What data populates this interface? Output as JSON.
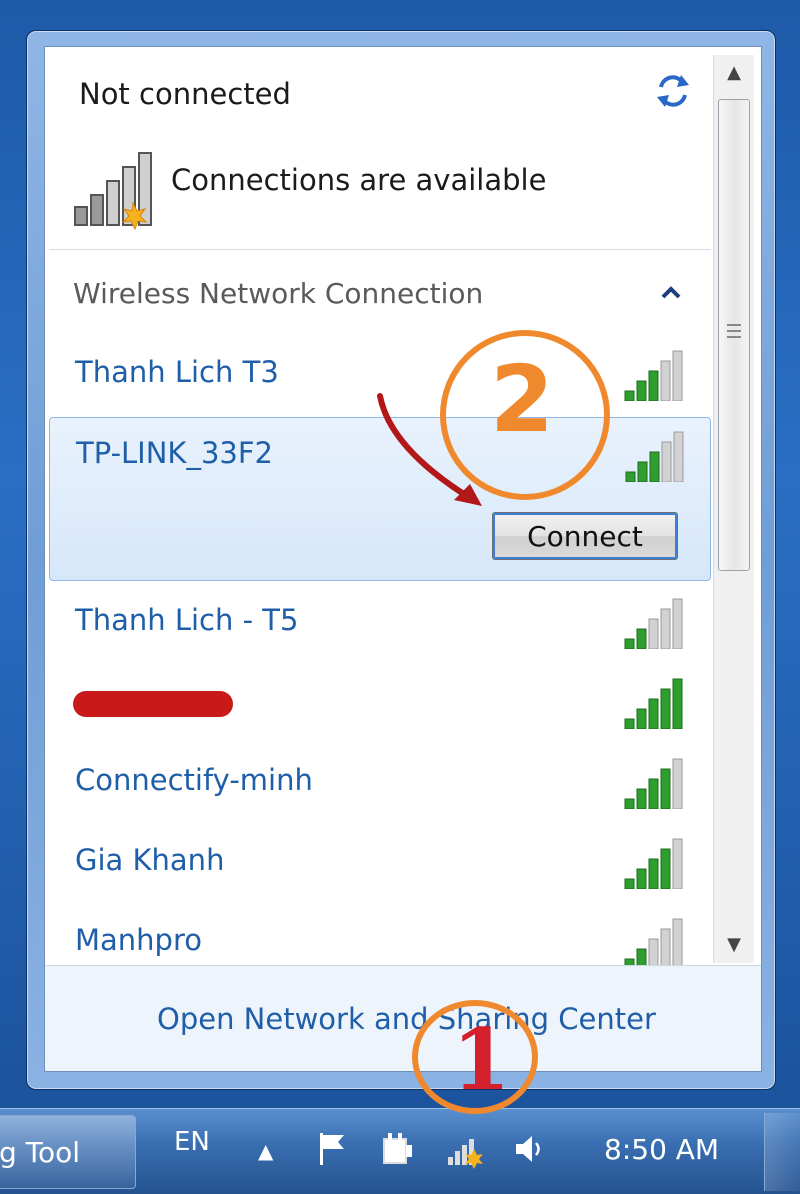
{
  "status": {
    "title": "Not connected",
    "available_text": "Connections are available"
  },
  "section": {
    "label": "Wireless Network Connection"
  },
  "networks": [
    {
      "name": "Thanh Lich T3",
      "bars": 3
    },
    {
      "name": "TP-LINK_33F2",
      "bars": 3,
      "selected": true
    },
    {
      "name": "Thanh Lich - T5",
      "bars": 2
    },
    {
      "name": "",
      "bars": 5,
      "redacted": true
    },
    {
      "name": "Connectify-minh",
      "bars": 4
    },
    {
      "name": "Gia Khanh",
      "bars": 4
    },
    {
      "name": "Manhpro",
      "bars": 2
    }
  ],
  "connect_button": {
    "label": "Connect"
  },
  "footer": {
    "link": "Open Network and Sharing Center"
  },
  "taskbar": {
    "task_label": "g Tool",
    "language": "EN",
    "clock": "8:50 AM"
  },
  "annotations": {
    "step1": "1",
    "step2": "2"
  },
  "colors": {
    "link_blue": "#1f5ea8",
    "signal_green": "#2e9e2e",
    "annotation_orange": "#f0892e",
    "annotation_red": "#d4202c"
  },
  "icons": [
    "refresh-icon",
    "signal-icon",
    "chevron-up-icon",
    "flag-icon",
    "power-icon",
    "network-icon",
    "speaker-icon"
  ]
}
